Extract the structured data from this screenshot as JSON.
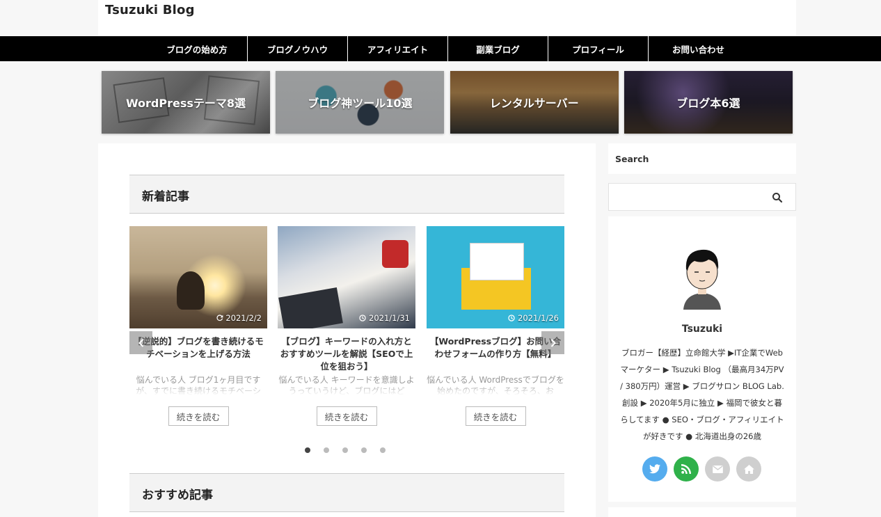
{
  "site": {
    "title": "Tsuzuki Blog"
  },
  "nav": {
    "items": [
      {
        "label": "ブログの始め方"
      },
      {
        "label": "ブログノウハウ"
      },
      {
        "label": "アフィリエイト"
      },
      {
        "label": "副業ブログ"
      },
      {
        "label": "プロフィール"
      },
      {
        "label": "お問い合わせ"
      }
    ]
  },
  "banners": [
    {
      "label": "WordPressテーマ8選"
    },
    {
      "label": "ブログ神ツール10選"
    },
    {
      "label": "レンタルサーバー"
    },
    {
      "label": "ブログ本6選"
    }
  ],
  "main": {
    "new_posts_heading": "新着記事",
    "recommended_heading": "おすすめ記事",
    "slider": {
      "cards": [
        {
          "date": "2021/2/2",
          "date_icon": "refresh-icon",
          "title": "【逆説的】ブログを書き続けるモチベーションを上げる方法",
          "excerpt": "悩んでいる人 ブログ1ヶ月目ですが、すでに書き続けるモチベーシ",
          "read_more": "続きを読む"
        },
        {
          "date": "2021/1/31",
          "date_icon": "clock-icon",
          "title": "【ブログ】キーワードの入れ方とおすすめツールを解説【SEOで上位を狙おう】",
          "excerpt": "悩んでいる人 キーワードを意識しようっていうけど、ブログにはど",
          "read_more": "続きを読む"
        },
        {
          "date": "2021/1/26",
          "date_icon": "clock-icon",
          "title": "【WordPressブログ】お問い合わせフォームの作り方【無料】",
          "excerpt": "悩んでいる人 WordPressでブログを始めたのですが、そろそろ、お",
          "read_more": "続きを読む"
        }
      ],
      "dots": 5,
      "active_dot": 1
    }
  },
  "sidebar": {
    "search_title": "Search",
    "search_placeholder": "",
    "profile": {
      "name": "Tsuzuki",
      "bio": "ブロガー【経歴】立命館大学 ▶IT企業でWebマーケター ▶ Tsuzuki Blog （最高月34万PV / 380万円）運営 ▶ ブログサロン BLOG Lab. 創設 ▶ 2020年5月に独立 ▶ 福岡で彼女と暮らしてます ● SEO・ブログ・アフィリエイトが好きです ● 北海道出身の26歳"
    },
    "social": [
      {
        "name": "twitter-icon",
        "color": "#55acee"
      },
      {
        "name": "rss-icon",
        "color": "#2fb14a"
      },
      {
        "name": "mail-icon",
        "color": "#cfcfcf"
      },
      {
        "name": "home-icon",
        "color": "#cfcfcf"
      }
    ]
  }
}
